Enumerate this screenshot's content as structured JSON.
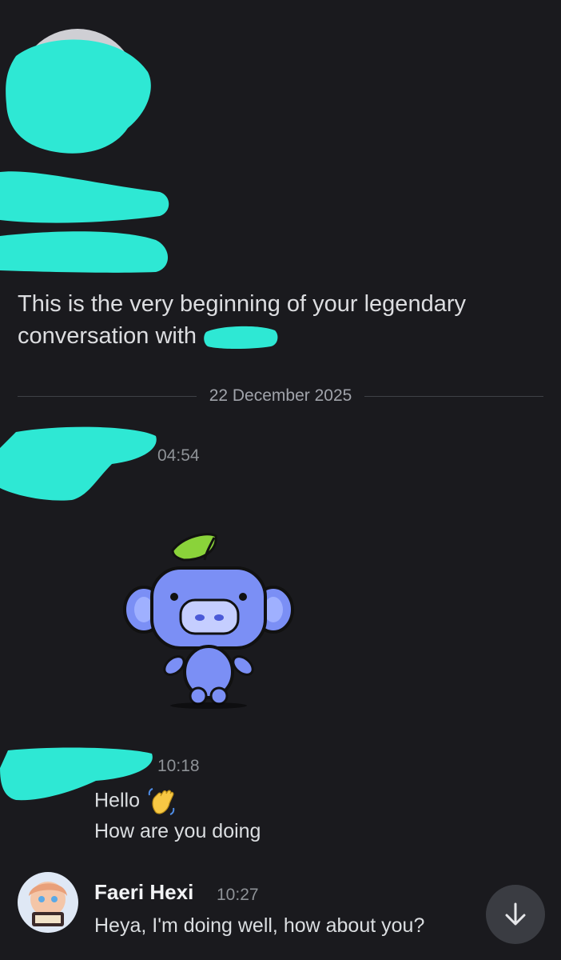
{
  "intro": {
    "text": "This is the very beginning of your legendary conversation with"
  },
  "divider": {
    "date": "22 December 2025"
  },
  "messages": [
    {
      "time": "04:54",
      "sticker": "wumpus-sticker"
    },
    {
      "time": "10:18",
      "lines": [
        "Hello",
        "How are you doing"
      ],
      "emoji": "waving-hand"
    },
    {
      "username": "Faeri Hexi",
      "time": "10:27",
      "text": "Heya, I'm doing well, how about you?"
    }
  ],
  "colors": {
    "background": "#1a1a1e",
    "redaction": "#2ee8d4",
    "wumpus": "#7b8ff5",
    "leaf": "#8ad33a"
  },
  "icons": {
    "scroll_down": "arrow-down-icon"
  }
}
